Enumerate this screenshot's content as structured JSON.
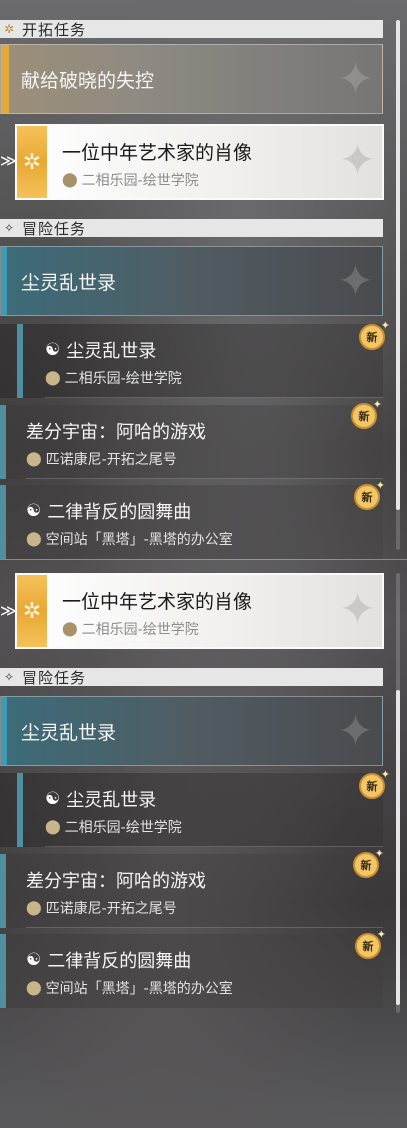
{
  "trailblaze": {
    "section_label": "开拓任务",
    "category_label": "献给破晓的失控"
  },
  "selected_quest": {
    "title": "一位中年艺术家的肖像",
    "location": "二相乐园-绘世学院"
  },
  "adventure": {
    "section_label": "冒险任务",
    "category_label": "尘灵乱世录",
    "quests": [
      {
        "title": "尘灵乱世录",
        "location": "二相乐园-绘世学院",
        "badge": "新"
      },
      {
        "title": "差分宇宙：阿哈的游戏",
        "location": "匹诺康尼-开拓之尾号",
        "badge": "新"
      },
      {
        "title": "二律背反的圆舞曲",
        "location": "空间站「黑塔」-黑塔的办公室",
        "badge": "新"
      }
    ]
  },
  "icons": {
    "section_trailblaze": "diamond-cross-icon",
    "section_adventure": "four-point-star-icon",
    "pointer": "double-chevron-right-icon",
    "location": "map-pin-icon",
    "quest_type": "mask-icon",
    "badge": "new-badge-icon"
  },
  "colors": {
    "accent_gold": "#e3a93a",
    "accent_teal": "#3d9bb3",
    "header_bg": "#e6e6e6"
  }
}
